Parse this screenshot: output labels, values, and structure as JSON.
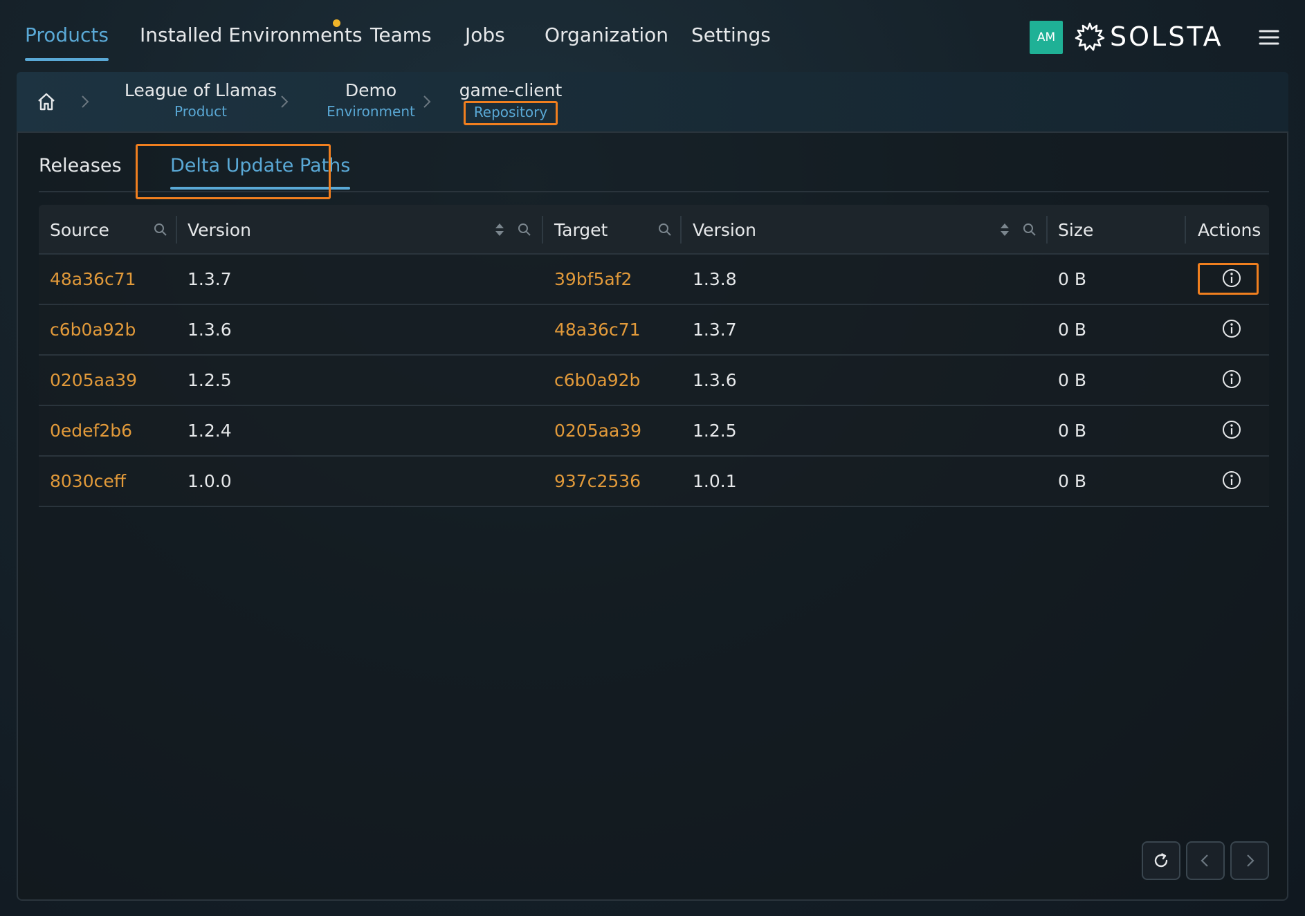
{
  "nav": {
    "tabs": [
      {
        "label": "Products"
      },
      {
        "label": "Installed Environments"
      },
      {
        "label": "Teams"
      },
      {
        "label": "Jobs"
      },
      {
        "label": "Organization"
      },
      {
        "label": "Settings"
      }
    ],
    "avatar_initials": "AM",
    "logo_text": "SOLSTA",
    "accent_color": "#5aa9d6",
    "notification_color": "#f0b429"
  },
  "breadcrumb": {
    "items": [
      {
        "name": "League of Llamas",
        "type": "Product"
      },
      {
        "name": "Demo",
        "type": "Environment"
      },
      {
        "name": "game-client",
        "type": "Repository"
      }
    ]
  },
  "subtabs": [
    {
      "label": "Releases"
    },
    {
      "label": "Delta Update Paths"
    }
  ],
  "table": {
    "headers": {
      "source": "Source",
      "source_version": "Version",
      "target": "Target",
      "target_version": "Version",
      "size": "Size",
      "actions": "Actions"
    },
    "rows": [
      {
        "source": "48a36c71",
        "source_version": "1.3.7",
        "target": "39bf5af2",
        "target_version": "1.3.8",
        "size": "0 B"
      },
      {
        "source": "c6b0a92b",
        "source_version": "1.3.6",
        "target": "48a36c71",
        "target_version": "1.3.7",
        "size": "0 B"
      },
      {
        "source": "0205aa39",
        "source_version": "1.2.5",
        "target": "c6b0a92b",
        "target_version": "1.3.6",
        "size": "0 B"
      },
      {
        "source": "0edef2b6",
        "source_version": "1.2.4",
        "target": "0205aa39",
        "target_version": "1.2.5",
        "size": "0 B"
      },
      {
        "source": "8030ceff",
        "source_version": "1.0.0",
        "target": "937c2536",
        "target_version": "1.0.1",
        "size": "0 B"
      }
    ],
    "link_color": "#e29a3a"
  },
  "footer": {
    "buttons": [
      "refresh-icon",
      "chevron-left-icon",
      "chevron-right-icon"
    ]
  },
  "highlight_color": "#f07f1f"
}
